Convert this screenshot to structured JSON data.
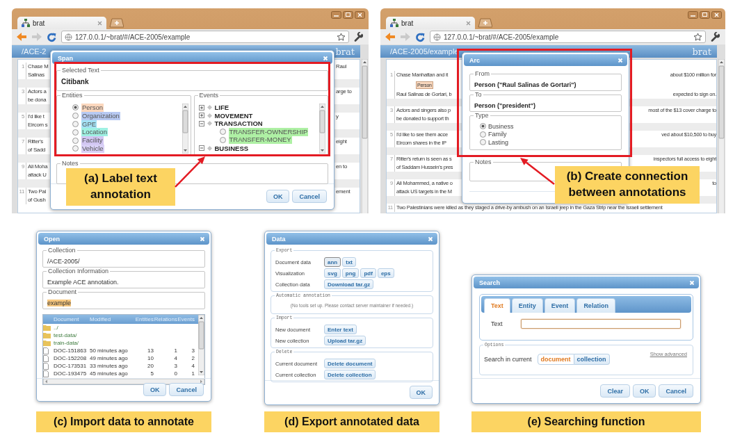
{
  "span_panel": {
    "kind": "span",
    "browser": {
      "tab_title": "brat",
      "url": "127.0.0.1/~brat/#/ACE-2005/example",
      "collection": "/ACE-2",
      "logo": "brat",
      "rows": [
        {
          "number": "1",
          "left": [
            "Chase M",
            "Salinas"
          ],
          "right": [
            "Raul"
          ]
        },
        {
          "number": "3",
          "left": [
            "Actors a",
            "be dona"
          ],
          "right": [
            "arge to"
          ]
        },
        {
          "number": "5",
          "left": [
            "I'd like t",
            "Eircom s"
          ],
          "right": [
            "y"
          ]
        },
        {
          "number": "7",
          "left": [
            "Ritter's",
            "of Sadd"
          ],
          "right": [
            "eight"
          ]
        },
        {
          "number": "9",
          "left": [
            "Ali Moha",
            "attack U"
          ],
          "right": [
            "en to"
          ]
        },
        {
          "number": "11",
          "left": [
            "Two Pal",
            "of Gush"
          ],
          "right": [
            "ement"
          ]
        }
      ]
    },
    "dialog": {
      "title": "Span",
      "selected_text_legend": "Selected Text",
      "selected_text": "Citibank",
      "entities_legend": "Entities",
      "entities": [
        {
          "label": "Person",
          "color": "#fbd7bd",
          "selected": true
        },
        {
          "label": "Organization",
          "color": "#b7c9f2",
          "selected": false
        },
        {
          "label": "GPE",
          "color": "#a4e2f5",
          "selected": false
        },
        {
          "label": "Location",
          "color": "#9ff0e2",
          "selected": false
        },
        {
          "label": "Facility",
          "color": "#d2c6f2",
          "selected": false
        },
        {
          "label": "Vehicle",
          "color": "#d9d0f6",
          "selected": false
        }
      ],
      "events_legend": "Events",
      "events": [
        {
          "label": "LIFE",
          "expanded": false
        },
        {
          "label": "MOVEMENT",
          "expanded": false
        },
        {
          "label": "TRANSACTION",
          "expanded": true,
          "children": [
            {
              "label": "TRANSFER-OWNERSHIP",
              "color": "#aef0a4",
              "selected": false
            },
            {
              "label": "TRANSFER-MONEY",
              "color": "#aef0a4",
              "selected": false
            }
          ]
        },
        {
          "label": "BUSINESS",
          "expanded": true
        }
      ],
      "notes_legend": "Notes",
      "buttons": [
        "OK",
        "Cancel"
      ]
    },
    "caption": "(a) Label text annotation"
  },
  "arc_panel": {
    "kind": "arc",
    "browser": {
      "tab_title": "brat",
      "url": "127.0.0.1/~brat/#/ACE-2005/example",
      "collection": "/ACE-2005/example",
      "logo": "brat",
      "rows": [
        {
          "number": "1",
          "left": [
            "Chase Manhattan and it",
            "Raul Salinas de Gortari, b"
          ],
          "tag": "Person",
          "right": [
            "about $100 million for",
            "expected to sign on."
          ]
        },
        {
          "number": "3",
          "left": [
            "Actors and singers also p",
            "be donated to support th"
          ],
          "right": [
            "most of the $13 cover charge to"
          ]
        },
        {
          "number": "5",
          "left": [
            "I'd like to see them acce",
            "Eircom shares in the IP"
          ],
          "right": [
            "ved about $10,500 to buy"
          ]
        },
        {
          "number": "7",
          "left": [
            "Ritter's return is seen as s",
            "of Saddam Hussein's pres"
          ],
          "right": [
            "inspectors full access to eight"
          ]
        },
        {
          "number": "9",
          "left": [
            "Ali Mohammed, a native o",
            "attack US targets in the M"
          ],
          "right": [
            "to"
          ]
        },
        {
          "number": "11",
          "left": [
            "Two Palestinians were killed as they staged a drive-by ambush on an Israeli jeep in the Gaza Strip near the Israeli settlement"
          ]
        }
      ]
    },
    "dialog": {
      "title": "Arc",
      "from_legend": "From",
      "from": "Person (\"Raul Salinas de Gortari\")",
      "to_legend": "To",
      "to": "Person (\"president\")",
      "type_legend": "Type",
      "types": [
        {
          "label": "Business",
          "selected": true
        },
        {
          "label": "Family",
          "selected": false
        },
        {
          "label": "Lasting",
          "selected": false
        }
      ],
      "notes_legend": "Notes"
    },
    "caption": "(b) Create connection between annotations"
  },
  "open_panel": {
    "kind": "open",
    "dialog": {
      "title": "Open",
      "collection_legend": "Collection",
      "collection": "/ACE-2005/",
      "info_legend": "Collection Information",
      "info": "Example ACE annotation.",
      "document_legend": "Document",
      "document": "example",
      "columns": [
        "Document",
        "Modified",
        "Entities",
        "Relations",
        "Events"
      ],
      "rows": [
        {
          "kind": "folder",
          "name": "../"
        },
        {
          "kind": "folder",
          "name": "test-data/"
        },
        {
          "kind": "folder",
          "name": "train-data/"
        },
        {
          "kind": "file",
          "name": "DOC-151863",
          "modified": "50 minutes ago",
          "entities": "13",
          "relations": "1",
          "events": "3"
        },
        {
          "kind": "file",
          "name": "DOC-152208",
          "modified": "49 minutes ago",
          "entities": "10",
          "relations": "4",
          "events": "2"
        },
        {
          "kind": "file",
          "name": "DOC-173531",
          "modified": "33 minutes ago",
          "entities": "20",
          "relations": "3",
          "events": "4"
        },
        {
          "kind": "file",
          "name": "DOC-193475",
          "modified": "45 minutes ago",
          "entities": "5",
          "relations": "0",
          "events": "1"
        }
      ],
      "buttons": [
        "OK",
        "Cancel"
      ]
    },
    "caption": "(c) Import data to annotate"
  },
  "data_panel": {
    "kind": "data",
    "dialog": {
      "title": "Data",
      "sections": [
        {
          "kind": "buttons",
          "legend": "Export",
          "rows": [
            {
              "label": "Document data",
              "buttons": [
                {
                  "label": "ann",
                  "selected": true
                },
                {
                  "label": "txt",
                  "selected": false
                }
              ]
            },
            {
              "label": "Visualization",
              "buttons": [
                {
                  "label": "svg"
                },
                {
                  "label": "png"
                },
                {
                  "label": "pdf"
                },
                {
                  "label": "eps"
                }
              ]
            },
            {
              "label": "Collection data",
              "buttons": [
                {
                  "label": "Download tar.gz"
                }
              ]
            }
          ]
        },
        {
          "kind": "note",
          "legend": "Automatic annotation",
          "note": "(No tools set up. Please contact server maintainer if needed.)"
        },
        {
          "kind": "buttons",
          "legend": "Import",
          "rows": [
            {
              "label": "New document",
              "buttons": [
                {
                  "label": "Enter text"
                }
              ]
            },
            {
              "label": "New collection",
              "buttons": [
                {
                  "label": "Upload tar.gz"
                }
              ]
            }
          ]
        },
        {
          "kind": "buttons",
          "legend": "Delete",
          "rows": [
            {
              "label": "Current document",
              "buttons": [
                {
                  "label": "Delete document"
                }
              ]
            },
            {
              "label": "Current collection",
              "buttons": [
                {
                  "label": "Delete collection"
                }
              ]
            }
          ]
        }
      ],
      "buttons": [
        "OK"
      ]
    },
    "caption": "(d) Export annotated data"
  },
  "search_panel": {
    "kind": "search",
    "dialog": {
      "title": "Search",
      "tabs": [
        {
          "label": "Text",
          "selected": true
        },
        {
          "label": "Entity",
          "selected": false
        },
        {
          "label": "Event",
          "selected": false
        },
        {
          "label": "Relation",
          "selected": false
        }
      ],
      "field_label": "Text",
      "options_legend": "Options",
      "scope_label": "Search in current",
      "scopes": [
        {
          "label": "document",
          "selected": true
        },
        {
          "label": "collection",
          "selected": false
        }
      ],
      "advanced_link": "Show advanced",
      "buttons": [
        "Clear",
        "OK",
        "Cancel"
      ]
    },
    "caption": "(e) Searching function"
  }
}
